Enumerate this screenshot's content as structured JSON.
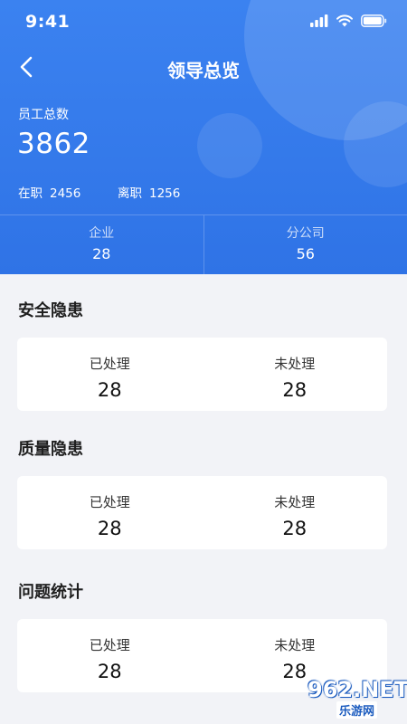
{
  "status_bar": {
    "time": "9:41"
  },
  "header": {
    "title": "领导总览",
    "total_label": "员工总数",
    "total_value": "3862",
    "active_label": "在职",
    "active_value": "2456",
    "left_label": "离职",
    "left_value": "1256",
    "stats": [
      {
        "label": "企业",
        "value": "28"
      },
      {
        "label": "分公司",
        "value": "56"
      }
    ]
  },
  "sections": [
    {
      "title": "安全隐患",
      "processed_label": "已处理",
      "processed_value": "28",
      "unprocessed_label": "未处理",
      "unprocessed_value": "28"
    },
    {
      "title": "质量隐患",
      "processed_label": "已处理",
      "processed_value": "28",
      "unprocessed_label": "未处理",
      "unprocessed_value": "28"
    },
    {
      "title": "问题统计",
      "processed_label": "已处理",
      "processed_value": "28",
      "unprocessed_label": "未处理",
      "unprocessed_value": "28"
    }
  ],
  "watermark": {
    "brand": "962.NET",
    "sub": "乐游网"
  },
  "colors": {
    "primary": "#3b82f0",
    "background": "#f2f3f7",
    "card": "#ffffff"
  },
  "icons": {
    "back": "chevron-left-icon",
    "signal": "signal-icon",
    "wifi": "wifi-icon",
    "battery": "battery-icon"
  }
}
